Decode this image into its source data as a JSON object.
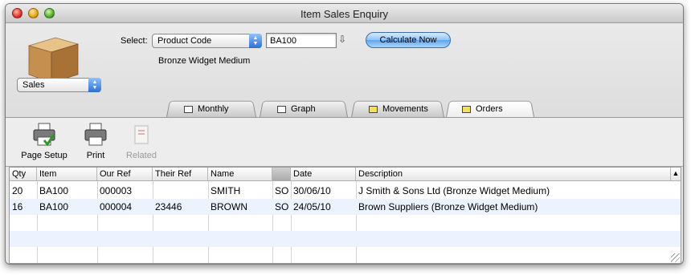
{
  "window": {
    "title": "Item Sales Enquiry"
  },
  "controls": {
    "select_label": "Select:",
    "select_value": "Product Code",
    "code_value": "BA100",
    "calc_label": "Calculate Now",
    "item_description": "Bronze Widget Medium",
    "mode_value": "Sales"
  },
  "tabs": [
    {
      "label": "Monthly",
      "icon": "calendar-icon"
    },
    {
      "label": "Graph",
      "icon": "graph-icon"
    },
    {
      "label": "Movements",
      "icon": "movements-icon"
    },
    {
      "label": "Orders",
      "icon": "orders-icon",
      "active": true
    }
  ],
  "toolbar": [
    {
      "label": "Page Setup",
      "icon": "page-setup-printer-icon",
      "enabled": true
    },
    {
      "label": "Print",
      "icon": "printer-icon",
      "enabled": true
    },
    {
      "label": "Related",
      "icon": "related-icon",
      "enabled": false
    }
  ],
  "table": {
    "columns": [
      "Qty",
      "Item",
      "Our Ref",
      "Their Ref",
      "Name",
      "",
      "Date",
      "Description"
    ],
    "rows": [
      [
        "20",
        "BA100",
        "000003",
        "",
        "SMITH",
        "SO",
        "30/06/10",
        "J Smith & Sons Ltd (Bronze Widget Medium)"
      ],
      [
        "16",
        "BA100",
        "000004",
        "23446",
        "BROWN",
        "SO",
        "24/05/10",
        "Brown Suppliers (Bronze Widget Medium)"
      ]
    ]
  },
  "colors": {
    "accent": "#3c6db3",
    "row_alt": "#edf3fe"
  }
}
